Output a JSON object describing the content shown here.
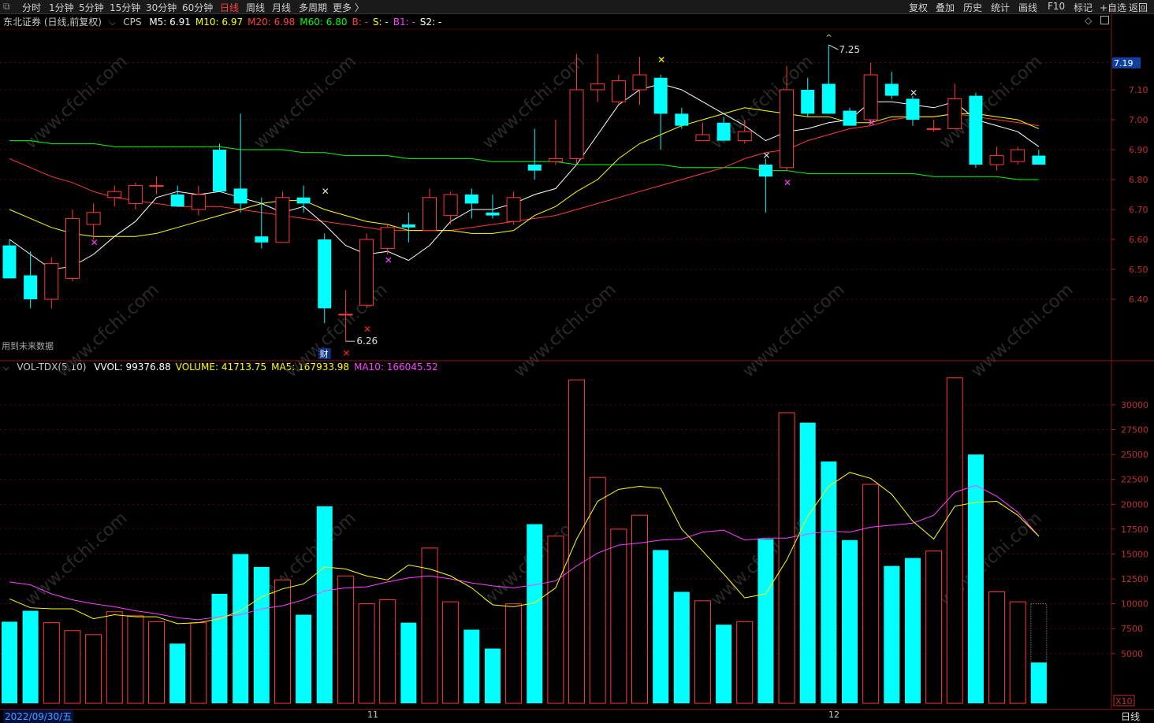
{
  "toolbar": {
    "left": [
      "分时",
      "1分钟",
      "5分钟",
      "15分钟",
      "30分钟",
      "60分钟",
      "日线",
      "周线",
      "月线",
      "多周期",
      "更多 〉"
    ],
    "active": "日线",
    "right": [
      "复权",
      "叠加",
      "历史",
      "统计",
      "画线",
      "F10",
      "标记",
      "+自选",
      "返回"
    ]
  },
  "price_panel": {
    "title": "东北证券 (日线,前复权)",
    "indicator": "CPS",
    "labels": [
      {
        "text": "M5: 6.91",
        "color": "#ffffff"
      },
      {
        "text": "M10: 6.97",
        "color": "#ffff00"
      },
      {
        "text": "M20: 6.98",
        "color": "#ff4040"
      },
      {
        "text": "M60: 6.80",
        "color": "#00ff00"
      },
      {
        "text": "B: -",
        "color": "#ff4040"
      },
      {
        "text": "S: -",
        "color": "#ffff00"
      },
      {
        "text": "B1: -",
        "color": "#ff40ff"
      },
      {
        "text": "S2: -",
        "color": "#ffffff"
      }
    ],
    "future_note": "用到未来数据",
    "high_label": "7.25",
    "low_label": "6.26",
    "fin_mark": "财",
    "current_price": "7.19",
    "y_ticks": [
      "7.10",
      "7.00",
      "6.90",
      "6.80",
      "6.70",
      "6.60",
      "6.50",
      "6.40"
    ]
  },
  "vol_panel": {
    "title": "VOL-TDX(5,10)",
    "labels": [
      {
        "text": "VVOL: 99376.88",
        "color": "#ffffff"
      },
      {
        "text": "VOLUME: 41713.75",
        "color": "#ffff00"
      },
      {
        "text": "MA5: 167933.98",
        "color": "#ffff00"
      },
      {
        "text": "MA10: 166045.52",
        "color": "#ff40ff"
      }
    ],
    "y_ticks": [
      "30000",
      "27500",
      "25000",
      "22500",
      "20000",
      "17500",
      "15000",
      "12500",
      "10000",
      "7500",
      "5000"
    ],
    "unit": "X10"
  },
  "bottom": {
    "date": "2022/09/30/五",
    "month_11": "11",
    "month_12": "12",
    "period": "日线"
  },
  "colors": {
    "up": "#ff3a3a",
    "down": "#00ffff",
    "ma5": "#ffffff",
    "ma10": "#ffff00",
    "ma20": "#ff3a3a",
    "ma60": "#00ff00"
  },
  "watermark": "www.cfchi.com",
  "chart_data": {
    "type": "candlestick",
    "ylim": [
      6.2,
      7.3
    ],
    "candles": [
      {
        "o": 6.58,
        "h": 6.6,
        "l": 6.47,
        "c": 6.47
      },
      {
        "o": 6.48,
        "h": 6.56,
        "l": 6.37,
        "c": 6.4
      },
      {
        "o": 6.4,
        "h": 6.54,
        "l": 6.37,
        "c": 6.52
      },
      {
        "o": 6.47,
        "h": 6.7,
        "l": 6.46,
        "c": 6.67
      },
      {
        "o": 6.65,
        "h": 6.72,
        "l": 6.6,
        "c": 6.69
      },
      {
        "o": 6.74,
        "h": 6.78,
        "l": 6.71,
        "c": 6.76
      },
      {
        "o": 6.72,
        "h": 6.79,
        "l": 6.7,
        "c": 6.78
      },
      {
        "o": 6.78,
        "h": 6.81,
        "l": 6.75,
        "c": 6.78
      },
      {
        "o": 6.75,
        "h": 6.78,
        "l": 6.71,
        "c": 6.71
      },
      {
        "o": 6.7,
        "h": 6.78,
        "l": 6.68,
        "c": 6.75
      },
      {
        "o": 6.9,
        "h": 6.92,
        "l": 6.76,
        "c": 6.76
      },
      {
        "o": 6.77,
        "h": 7.02,
        "l": 6.69,
        "c": 6.72
      },
      {
        "o": 6.61,
        "h": 6.74,
        "l": 6.57,
        "c": 6.59
      },
      {
        "o": 6.59,
        "h": 6.76,
        "l": 6.59,
        "c": 6.74
      },
      {
        "o": 6.74,
        "h": 6.78,
        "l": 6.69,
        "c": 6.72
      },
      {
        "o": 6.6,
        "h": 6.62,
        "l": 6.32,
        "c": 6.37
      },
      {
        "o": 6.35,
        "h": 6.43,
        "l": 6.26,
        "c": 6.35
      },
      {
        "o": 6.38,
        "h": 6.62,
        "l": 6.37,
        "c": 6.6
      },
      {
        "o": 6.57,
        "h": 6.65,
        "l": 6.55,
        "c": 6.64
      },
      {
        "o": 6.65,
        "h": 6.69,
        "l": 6.59,
        "c": 6.64
      },
      {
        "o": 6.63,
        "h": 6.77,
        "l": 6.63,
        "c": 6.74
      },
      {
        "o": 6.68,
        "h": 6.76,
        "l": 6.65,
        "c": 6.75
      },
      {
        "o": 6.75,
        "h": 6.77,
        "l": 6.67,
        "c": 6.72
      },
      {
        "o": 6.69,
        "h": 6.75,
        "l": 6.67,
        "c": 6.68
      },
      {
        "o": 6.66,
        "h": 6.76,
        "l": 6.65,
        "c": 6.74
      },
      {
        "o": 6.85,
        "h": 6.97,
        "l": 6.8,
        "c": 6.83
      },
      {
        "o": 6.86,
        "h": 7.0,
        "l": 6.85,
        "c": 6.87
      },
      {
        "o": 6.87,
        "h": 7.22,
        "l": 6.85,
        "c": 7.1
      },
      {
        "o": 7.1,
        "h": 7.22,
        "l": 7.06,
        "c": 7.12
      },
      {
        "o": 7.06,
        "h": 7.15,
        "l": 7.05,
        "c": 7.13
      },
      {
        "o": 7.1,
        "h": 7.21,
        "l": 7.05,
        "c": 7.15
      },
      {
        "o": 7.14,
        "h": 7.15,
        "l": 6.9,
        "c": 7.02
      },
      {
        "o": 7.02,
        "h": 7.04,
        "l": 6.97,
        "c": 6.98
      },
      {
        "o": 6.93,
        "h": 6.99,
        "l": 6.93,
        "c": 6.95
      },
      {
        "o": 6.99,
        "h": 7.01,
        "l": 6.93,
        "c": 6.93
      },
      {
        "o": 6.93,
        "h": 7.0,
        "l": 6.92,
        "c": 6.96
      },
      {
        "o": 6.85,
        "h": 6.87,
        "l": 6.69,
        "c": 6.81
      },
      {
        "o": 6.84,
        "h": 7.18,
        "l": 6.83,
        "c": 7.1
      },
      {
        "o": 7.1,
        "h": 7.14,
        "l": 7.01,
        "c": 7.02
      },
      {
        "o": 7.12,
        "h": 7.25,
        "l": 7.02,
        "c": 7.02
      },
      {
        "o": 7.03,
        "h": 7.04,
        "l": 6.98,
        "c": 6.98
      },
      {
        "o": 7.0,
        "h": 7.19,
        "l": 6.99,
        "c": 7.15
      },
      {
        "o": 7.12,
        "h": 7.16,
        "l": 7.07,
        "c": 7.08
      },
      {
        "o": 7.07,
        "h": 7.08,
        "l": 6.98,
        "c": 7.0
      },
      {
        "o": 6.97,
        "h": 7.0,
        "l": 6.96,
        "c": 6.97
      },
      {
        "o": 6.97,
        "h": 7.12,
        "l": 6.97,
        "c": 7.07
      },
      {
        "o": 7.08,
        "h": 7.09,
        "l": 6.84,
        "c": 6.85
      },
      {
        "o": 6.85,
        "h": 6.91,
        "l": 6.83,
        "c": 6.88
      },
      {
        "o": 6.86,
        "h": 6.91,
        "l": 6.85,
        "c": 6.9
      },
      {
        "o": 6.88,
        "h": 6.9,
        "l": 6.85,
        "c": 6.85
      }
    ],
    "ma5": [
      6.6,
      6.55,
      6.5,
      6.51,
      6.55,
      6.61,
      6.66,
      6.74,
      6.76,
      6.75,
      6.76,
      6.74,
      6.72,
      6.69,
      6.71,
      6.65,
      6.58,
      6.55,
      6.56,
      6.53,
      6.58,
      6.66,
      6.7,
      6.7,
      6.72,
      6.75,
      6.77,
      6.85,
      6.95,
      7.05,
      7.1,
      7.12,
      7.1,
      7.06,
      7.02,
      6.98,
      6.93,
      6.96,
      6.97,
      6.99,
      7.0,
      7.06,
      7.06,
      7.05,
      7.04,
      7.06,
      7.0,
      6.98,
      6.96,
      6.91
    ],
    "ma10": [
      6.7,
      6.67,
      6.64,
      6.62,
      6.61,
      6.61,
      6.61,
      6.62,
      6.64,
      6.66,
      6.68,
      6.7,
      6.72,
      6.73,
      6.73,
      6.7,
      6.68,
      6.66,
      6.65,
      6.63,
      6.63,
      6.63,
      6.62,
      6.62,
      6.63,
      6.68,
      6.71,
      6.76,
      6.8,
      6.87,
      6.92,
      6.95,
      6.98,
      7.0,
      7.02,
      7.04,
      7.03,
      7.02,
      7.01,
      7.01,
      6.99,
      6.99,
      7.01,
      7.01,
      7.01,
      7.02,
      7.02,
      7.01,
      7.0,
      6.97
    ],
    "ma20": [
      6.87,
      6.84,
      6.81,
      6.79,
      6.76,
      6.74,
      6.73,
      6.72,
      6.71,
      6.71,
      6.71,
      6.7,
      6.69,
      6.68,
      6.67,
      6.66,
      6.65,
      6.64,
      6.63,
      6.63,
      6.63,
      6.63,
      6.64,
      6.65,
      6.66,
      6.67,
      6.68,
      6.7,
      6.72,
      6.74,
      6.76,
      6.78,
      6.8,
      6.82,
      6.84,
      6.87,
      6.89,
      6.9,
      6.93,
      6.95,
      6.97,
      6.98,
      7.0,
      7.01,
      7.01,
      7.02,
      7.01,
      7.0,
      6.99,
      6.98
    ],
    "ma60": [
      6.93,
      6.93,
      6.92,
      6.92,
      6.92,
      6.91,
      6.91,
      6.91,
      6.91,
      6.91,
      6.91,
      6.9,
      6.9,
      6.9,
      6.89,
      6.89,
      6.88,
      6.88,
      6.88,
      6.87,
      6.87,
      6.87,
      6.87,
      6.86,
      6.86,
      6.86,
      6.86,
      6.85,
      6.85,
      6.85,
      6.85,
      6.85,
      6.84,
      6.84,
      6.84,
      6.84,
      6.83,
      6.83,
      6.82,
      6.82,
      6.82,
      6.82,
      6.82,
      6.82,
      6.81,
      6.81,
      6.81,
      6.81,
      6.8,
      6.8
    ],
    "volume": [
      8200,
      9300,
      8100,
      7300,
      6900,
      9200,
      8800,
      8200,
      6000,
      8100,
      11000,
      15000,
      13700,
      12400,
      8900,
      19800,
      12800,
      10000,
      10400,
      8100,
      15600,
      10200,
      7400,
      5500,
      10000,
      18000,
      16800,
      32500,
      22700,
      17500,
      18900,
      15400,
      11200,
      10300,
      7900,
      8200,
      16500,
      29200,
      28200,
      24300,
      16400,
      22000,
      13800,
      14600,
      15300,
      32700,
      25000,
      11200,
      10200,
      4100
    ],
    "vol_ma5": [
      10500,
      9600,
      9500,
      9500,
      8500,
      8900,
      8700,
      8700,
      8000,
      8100,
      8500,
      9300,
      10700,
      11500,
      12000,
      13700,
      13500,
      12800,
      12400,
      13900,
      13500,
      12800,
      11600,
      9900,
      9700,
      10100,
      11600,
      16500,
      20300,
      21500,
      21800,
      21600,
      17500,
      15300,
      13000,
      10600,
      11000,
      14400,
      18800,
      21800,
      23200,
      22600,
      21000,
      18300,
      16500,
      19800,
      20200,
      20300,
      18900,
      16800
    ],
    "vol_ma10": [
      12200,
      11900,
      11000,
      10400,
      10000,
      9700,
      9300,
      9000,
      8600,
      8400,
      8700,
      8900,
      9500,
      9800,
      10400,
      11300,
      11600,
      11700,
      12200,
      12600,
      12800,
      12500,
      12100,
      11800,
      11600,
      11900,
      12300,
      13800,
      15100,
      15900,
      16100,
      16400,
      16500,
      17200,
      17400,
      16400,
      16600,
      16600,
      17000,
      17300,
      17200,
      17700,
      17900,
      18100,
      18900,
      21200,
      21900,
      20800,
      19200,
      16800
    ]
  }
}
